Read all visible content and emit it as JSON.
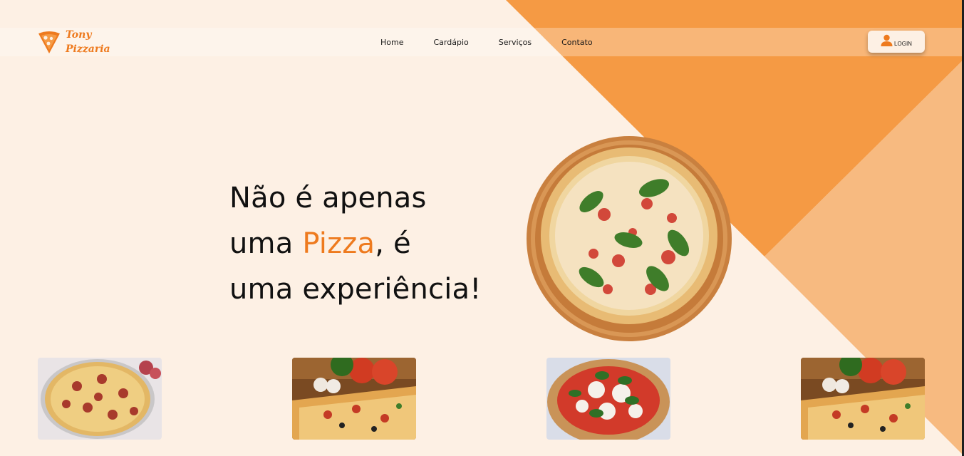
{
  "brand": {
    "name_line1": "Tony",
    "name_line2": "Pizzaria",
    "logo_icon": "pizza-slice-icon",
    "accent_color": "#ee7a1e"
  },
  "nav": {
    "links": [
      "Home",
      "Cardápio",
      "Serviços",
      "Contato"
    ]
  },
  "login": {
    "label": "LOGIN",
    "icon": "user-icon"
  },
  "hero": {
    "line1": "Não é apenas",
    "line2_prefix": "uma ",
    "line2_accent": "Pizza",
    "line2_suffix": ", é",
    "line3": "uma experiência!",
    "image": "pizza-margherita-on-board"
  },
  "gallery": {
    "images": [
      "pepperoni-pizza-photo",
      "vegetable-pizza-with-tomatoes-photo",
      "margherita-pizza-photo",
      "vegetable-pizza-with-tomatoes-photo"
    ]
  },
  "colors": {
    "background": "#fdf0e4",
    "orange": "#f59a44",
    "light_orange": "#f7ba80"
  }
}
